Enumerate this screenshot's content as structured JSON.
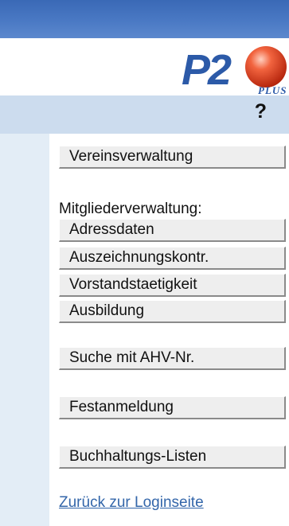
{
  "logo": {
    "wordmark": "P2",
    "tagline": "PLUS"
  },
  "help": {
    "label": "?"
  },
  "menu": {
    "vereinsverwaltung": "Vereinsverwaltung",
    "mitglieder_heading": "Mitgliederverwaltung:",
    "adressdaten": "Adressdaten",
    "auszeichnungskontr": "Auszeichnungskontr.",
    "vorstandstaetigkeit": "Vorstandstaetigkeit",
    "ausbildung": "Ausbildung",
    "suche_ahv": "Suche mit AHV-Nr.",
    "festanmeldung": "Festanmeldung",
    "buchhaltungs_listen": "Buchhaltungs-Listen",
    "zurueck_login": "Zurück zur Loginseite"
  },
  "colors": {
    "topbar": "#4a79c4",
    "help_bar": "#ccdcee",
    "left_panel": "#e3edf6",
    "button_face": "#eeeeee",
    "link": "#3366aa",
    "logo_text": "#2c5aa8",
    "logo_ball": "#e0452a"
  }
}
